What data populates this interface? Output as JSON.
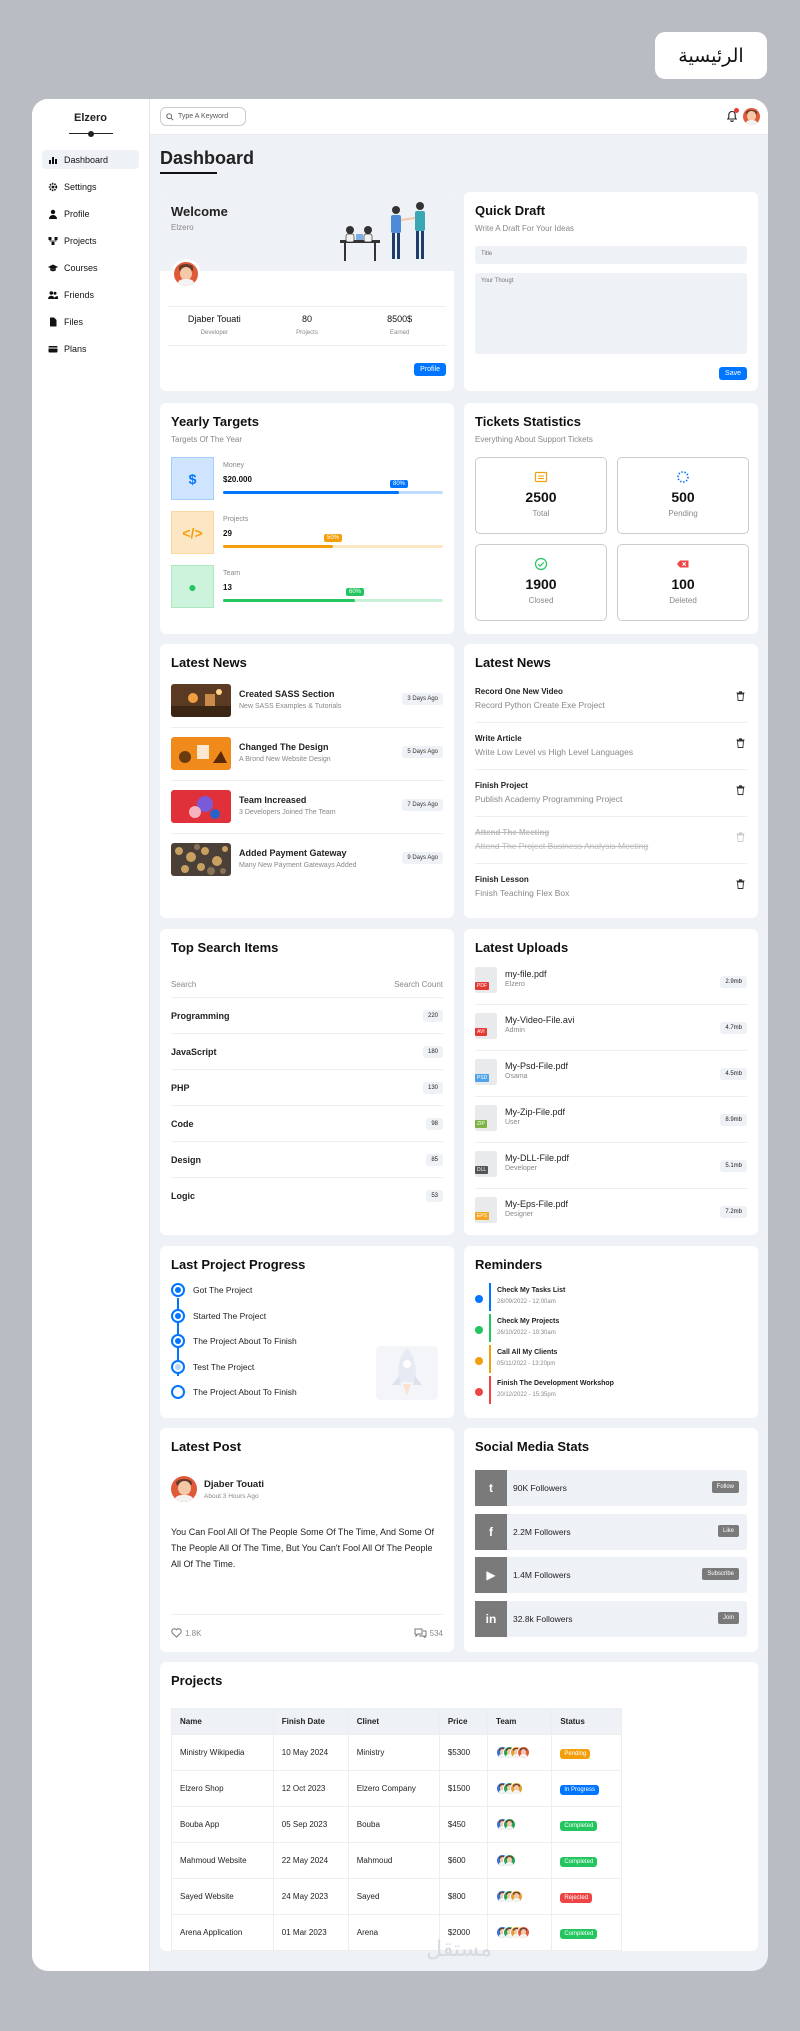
{
  "header_tag": "الرئيسية",
  "brand": "Elzero",
  "nav": [
    {
      "label": "Dashboard",
      "icon": "chart-bar-icon",
      "active": true
    },
    {
      "label": "Settings",
      "icon": "gear-icon"
    },
    {
      "label": "Profile",
      "icon": "user-icon"
    },
    {
      "label": "Projects",
      "icon": "diagram-icon"
    },
    {
      "label": "Courses",
      "icon": "graduation-cap-icon"
    },
    {
      "label": "Friends",
      "icon": "users-icon"
    },
    {
      "label": "Files",
      "icon": "file-icon"
    },
    {
      "label": "Plans",
      "icon": "credit-card-icon"
    }
  ],
  "topbar": {
    "search_placeholder": "Type A Keyword"
  },
  "page_title": "Dashboard",
  "welcome": {
    "title": "Welcome",
    "subtitle": "Elzero",
    "stats": [
      {
        "value": "Djaber Touati",
        "label": "Developer"
      },
      {
        "value": "80",
        "label": "Projects"
      },
      {
        "value": "8500$",
        "label": "Earned"
      }
    ],
    "button": "Profile"
  },
  "quick_draft": {
    "title": "Quick Draft",
    "subtitle": "Write A Draft For Your Ideas",
    "title_placeholder": "Title",
    "body_placeholder": "Your Thougt",
    "button": "Save"
  },
  "yearly_targets": {
    "title": "Yearly Targets",
    "subtitle": "Targets Of The Year",
    "items": [
      {
        "label": "Money",
        "value": "$20.000",
        "percent": 80,
        "percent_label": "80%",
        "icon_glyph": "$",
        "color": "#0075ff",
        "bg": "#cfe4ff"
      },
      {
        "label": "Projects",
        "value": "29",
        "percent": 50,
        "percent_label": "50%",
        "icon_glyph": "</>",
        "color": "#f59e0b",
        "bg": "#fde6c4"
      },
      {
        "label": "Team",
        "value": "13",
        "percent": 60,
        "percent_label": "60%",
        "icon_glyph": "●",
        "color": "#22c55e",
        "bg": "#cdf3dc"
      }
    ]
  },
  "tickets": {
    "title": "Tickets Statistics",
    "subtitle": "Everything About Support Tickets",
    "items": [
      {
        "value": "2500",
        "label": "Total",
        "color": "#f59e0b"
      },
      {
        "value": "500",
        "label": "Pending",
        "color": "#0075ff"
      },
      {
        "value": "1900",
        "label": "Closed",
        "color": "#22c55e"
      },
      {
        "value": "100",
        "label": "Deleted",
        "color": "#ef4444"
      }
    ]
  },
  "latest_news": {
    "title": "Latest News",
    "items": [
      {
        "title": "Created SASS Section",
        "sub": "New SASS Examples & Tutorials",
        "date": "3 Days Ago"
      },
      {
        "title": "Changed The Design",
        "sub": "A Brond New Website Design",
        "date": "5 Days Ago"
      },
      {
        "title": "Team Increased",
        "sub": "3 Developers Joined The Team",
        "date": "7 Days Ago"
      },
      {
        "title": "Added Payment Gateway",
        "sub": "Many New Payment Gateways Added",
        "date": "9 Days Ago"
      }
    ]
  },
  "latest_tasks": {
    "title": "Latest News",
    "items": [
      {
        "title": "Record One New Video",
        "sub": "Record Python Create Exe Project",
        "done": false
      },
      {
        "title": "Write Article",
        "sub": "Write Low Level vs High Level Languages",
        "done": false
      },
      {
        "title": "Finish Project",
        "sub": "Publish Academy Programming Project",
        "done": false
      },
      {
        "title": "Attend The Meeting",
        "sub": "Attend The Project Business Analysis Meeting",
        "done": true
      },
      {
        "title": "Finish Lesson",
        "sub": "Finish Teaching Flex Box",
        "done": false
      }
    ]
  },
  "top_search": {
    "title": "Top Search Items",
    "col1": "Search",
    "col2": "Search Count",
    "items": [
      {
        "name": "Programming",
        "count": "220"
      },
      {
        "name": "JavaScript",
        "count": "180"
      },
      {
        "name": "PHP",
        "count": "130"
      },
      {
        "name": "Code",
        "count": "98"
      },
      {
        "name": "Design",
        "count": "85"
      },
      {
        "name": "Logic",
        "count": "53"
      }
    ]
  },
  "uploads": {
    "title": "Latest Uploads",
    "items": [
      {
        "name": "my-file.pdf",
        "by": "Elzero",
        "size": "2.9mb",
        "tag": "PDF",
        "color": "#e53935"
      },
      {
        "name": "My-Video-File.avi",
        "by": "Admin",
        "size": "4.7mb",
        "tag": "AVI",
        "color": "#e53935"
      },
      {
        "name": "My-Psd-File.pdf",
        "by": "Osama",
        "size": "4.5mb",
        "tag": "PSD",
        "color": "#4fa3e8"
      },
      {
        "name": "My-Zip-File.pdf",
        "by": "User",
        "size": "8.9mb",
        "tag": "ZIP",
        "color": "#7cb342"
      },
      {
        "name": "My-DLL-File.pdf",
        "by": "Developer",
        "size": "5.1mb",
        "tag": "DLL",
        "color": "#555555"
      },
      {
        "name": "My-Eps-File.pdf",
        "by": "Designer",
        "size": "7.2mb",
        "tag": "EPS",
        "color": "#f5a623"
      }
    ]
  },
  "progress": {
    "title": "Last Project Progress",
    "steps": [
      {
        "label": "Got The Project",
        "state": "done"
      },
      {
        "label": "Started The Project",
        "state": "done"
      },
      {
        "label": "The Project About To Finish",
        "state": "done"
      },
      {
        "label": "Test The Project",
        "state": "light"
      },
      {
        "label": "The Project About To Finish",
        "state": "empty"
      }
    ]
  },
  "reminders": {
    "title": "Reminders",
    "items": [
      {
        "title": "Check My Tasks List",
        "date": "28/09/2022 - 12:00am",
        "color": "#0075ff"
      },
      {
        "title": "Check My Projects",
        "date": "26/10/2022 - 10:30am",
        "color": "#22c55e"
      },
      {
        "title": "Call All My Clients",
        "date": "05/11/2022 - 13:20pm",
        "color": "#f59e0b"
      },
      {
        "title": "Finish The Development Workshop",
        "date": "20/12/2022 - 15:35pm",
        "color": "#ef4444"
      }
    ]
  },
  "post": {
    "title": "Latest Post",
    "author": "Djaber Touati",
    "time": "About 3 Hours Ago",
    "body": "You Can Fool All Of The People Some Of The Time, And Some Of The People All Of The Time, But You Can't Fool All Of The People All Of The Time.",
    "likes": "1.8K",
    "comments": "534"
  },
  "social": {
    "title": "Social Media Stats",
    "items": [
      {
        "text": "90K Followers",
        "button": "Follow",
        "icon": "twitter-icon",
        "glyph": "t",
        "color": "#7a7a7a"
      },
      {
        "text": "2.2M Followers",
        "button": "Like",
        "icon": "facebook-icon",
        "glyph": "f",
        "color": "#7a7a7a"
      },
      {
        "text": "1.4M Followers",
        "button": "Subscribe",
        "icon": "youtube-icon",
        "glyph": "▶",
        "color": "#7a7a7a"
      },
      {
        "text": "32.8k Followers",
        "button": "Join",
        "icon": "linkedin-icon",
        "glyph": "in",
        "color": "#7a7a7a"
      }
    ]
  },
  "projects": {
    "title": "Projects",
    "columns": [
      "Name",
      "Finish Date",
      "Clinet",
      "Price",
      "Team",
      "Status"
    ],
    "rows": [
      {
        "name": "Ministry Wikipedia",
        "date": "10 May 2024",
        "client": "Ministry",
        "price": "$5300",
        "team": 4,
        "status": "Pending",
        "color": "#f59e0b"
      },
      {
        "name": "Elzero Shop",
        "date": "12 Oct 2023",
        "client": "Elzero Company",
        "price": "$1500",
        "team": 3,
        "status": "In Progress",
        "color": "#0075ff"
      },
      {
        "name": "Bouba App",
        "date": "05 Sep 2023",
        "client": "Bouba",
        "price": "$450",
        "team": 2,
        "status": "Completed",
        "color": "#22c55e"
      },
      {
        "name": "Mahmoud Website",
        "date": "22 May 2024",
        "client": "Mahmoud",
        "price": "$600",
        "team": 2,
        "status": "Completed",
        "color": "#22c55e"
      },
      {
        "name": "Sayed Website",
        "date": "24 May 2023",
        "client": "Sayed",
        "price": "$800",
        "team": 3,
        "status": "Rejected",
        "color": "#ef4444"
      },
      {
        "name": "Arena Application",
        "date": "01 Mar 2023",
        "client": "Arena",
        "price": "$2000",
        "team": 4,
        "status": "Completed",
        "color": "#22c55e"
      }
    ]
  },
  "watermark": "مستقل"
}
